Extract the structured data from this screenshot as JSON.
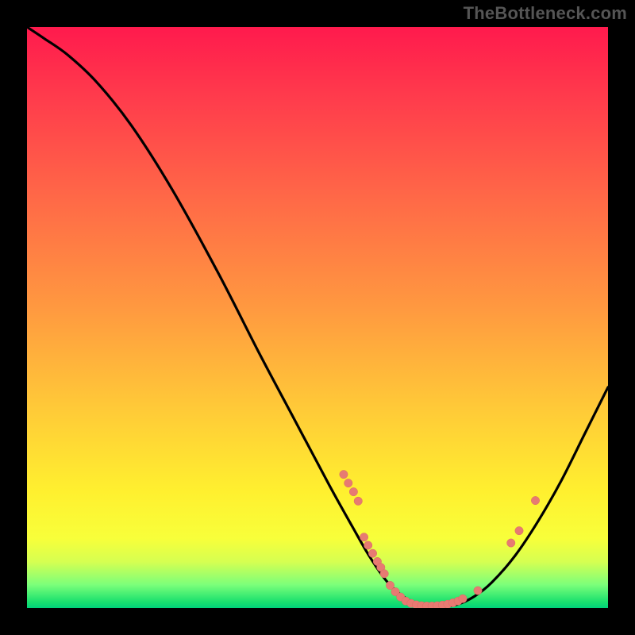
{
  "watermark_text": "TheBottleneck.com",
  "colors": {
    "frame": "#000000",
    "gradient_top": "#ff1a4d",
    "gradient_mid": "#ffc838",
    "gradient_bottom": "#00d27a",
    "curve": "#000000",
    "points": "#e77a72"
  },
  "chart_data": {
    "type": "line",
    "title": "",
    "xlabel": "",
    "ylabel": "",
    "xlim": [
      0,
      100
    ],
    "ylim": [
      0,
      100
    ],
    "curve_samples": [
      {
        "x": 0,
        "y": 100
      },
      {
        "x": 3,
        "y": 98
      },
      {
        "x": 7,
        "y": 95.2
      },
      {
        "x": 12,
        "y": 90.5
      },
      {
        "x": 18,
        "y": 83
      },
      {
        "x": 25,
        "y": 72
      },
      {
        "x": 33,
        "y": 57.5
      },
      {
        "x": 40,
        "y": 43.8
      },
      {
        "x": 46,
        "y": 32.5
      },
      {
        "x": 52,
        "y": 21.2
      },
      {
        "x": 56,
        "y": 14
      },
      {
        "x": 59,
        "y": 8.8
      },
      {
        "x": 62,
        "y": 4.5
      },
      {
        "x": 65,
        "y": 1.8
      },
      {
        "x": 68,
        "y": 0.5
      },
      {
        "x": 71,
        "y": 0.2
      },
      {
        "x": 74,
        "y": 0.6
      },
      {
        "x": 77,
        "y": 2.0
      },
      {
        "x": 80,
        "y": 4.4
      },
      {
        "x": 84,
        "y": 9.0
      },
      {
        "x": 88,
        "y": 15.0
      },
      {
        "x": 92,
        "y": 22.0
      },
      {
        "x": 96,
        "y": 30.0
      },
      {
        "x": 100,
        "y": 38.0
      }
    ],
    "highlight_points": [
      {
        "x": 54.5,
        "y": 23.0
      },
      {
        "x": 55.3,
        "y": 21.5
      },
      {
        "x": 56.2,
        "y": 20.0
      },
      {
        "x": 57.0,
        "y": 18.4
      },
      {
        "x": 58.0,
        "y": 12.2
      },
      {
        "x": 58.7,
        "y": 10.8
      },
      {
        "x": 59.5,
        "y": 9.4
      },
      {
        "x": 60.3,
        "y": 8.0
      },
      {
        "x": 60.9,
        "y": 7.0
      },
      {
        "x": 61.5,
        "y": 5.9
      },
      {
        "x": 62.5,
        "y": 3.9
      },
      {
        "x": 63.4,
        "y": 2.8
      },
      {
        "x": 64.3,
        "y": 1.9
      },
      {
        "x": 65.2,
        "y": 1.2
      },
      {
        "x": 66.1,
        "y": 0.8
      },
      {
        "x": 67.0,
        "y": 0.55
      },
      {
        "x": 67.9,
        "y": 0.4
      },
      {
        "x": 68.8,
        "y": 0.35
      },
      {
        "x": 69.7,
        "y": 0.35
      },
      {
        "x": 70.6,
        "y": 0.4
      },
      {
        "x": 71.5,
        "y": 0.5
      },
      {
        "x": 72.4,
        "y": 0.65
      },
      {
        "x": 73.3,
        "y": 0.9
      },
      {
        "x": 74.2,
        "y": 1.2
      },
      {
        "x": 75.0,
        "y": 1.6
      },
      {
        "x": 77.6,
        "y": 3.0
      },
      {
        "x": 83.3,
        "y": 11.2
      },
      {
        "x": 84.7,
        "y": 13.3
      },
      {
        "x": 87.5,
        "y": 18.5
      }
    ]
  }
}
